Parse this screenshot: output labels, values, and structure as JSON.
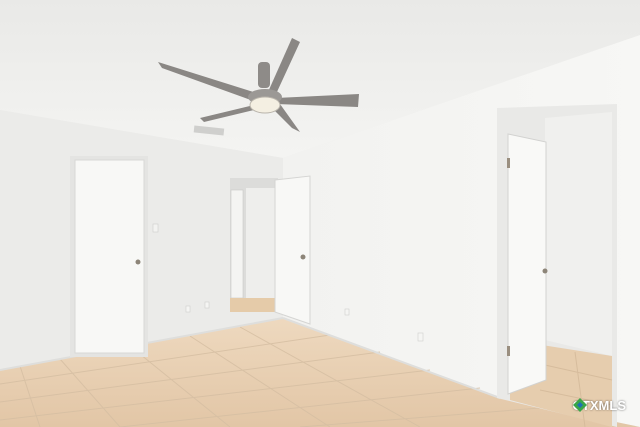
{
  "photo": {
    "subject": "empty-bedroom-with-ceiling-fan",
    "colors": {
      "ceiling": "#f1f1ef",
      "wall_left": "#ececea",
      "wall_right": "#f3f3f1",
      "floor": "#e8cfb2",
      "tile_grout": "#d5bea2",
      "door": "#f7f7f5",
      "fan_blade": "#8a8784",
      "fan_light": "#f4efe2"
    }
  },
  "watermark": {
    "text": "CTXMLS",
    "colors": {
      "green": "#3aa548",
      "blue": "#1f6fb5"
    }
  }
}
